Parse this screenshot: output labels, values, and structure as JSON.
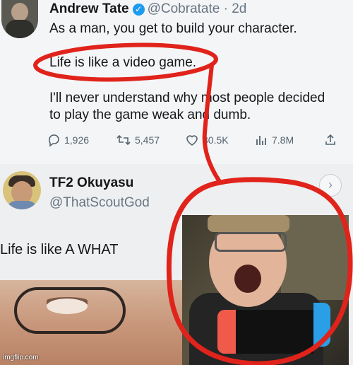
{
  "tweet_original": {
    "author_name": "Andrew Tate",
    "verified_icon": "✓",
    "handle_and_time": "@Cobratate · 2d",
    "lines": [
      "As a man, you get to build your character.",
      "Life is like a video game.",
      "I'll never understand why most people decided",
      "to play the game weak and dumb."
    ],
    "actions": {
      "replies": "1,926",
      "retweets": "5,457",
      "likes": "30.5K",
      "views": "7.8M"
    }
  },
  "tweet_reply": {
    "author_name": "TF2 Okuyasu",
    "handle": "@ThatScoutGod",
    "text": "Life is like A WHAT",
    "more_icon": "›"
  },
  "watermark": "imgflip.com",
  "colors": {
    "annotation_red": "#e0231b",
    "verified_blue": "#1d9bf0",
    "muted_text": "#687684"
  },
  "icons": {
    "reply": "reply-icon",
    "retweet": "retweet-icon",
    "like": "heart-icon",
    "views": "analytics-icon",
    "share": "share-icon"
  }
}
